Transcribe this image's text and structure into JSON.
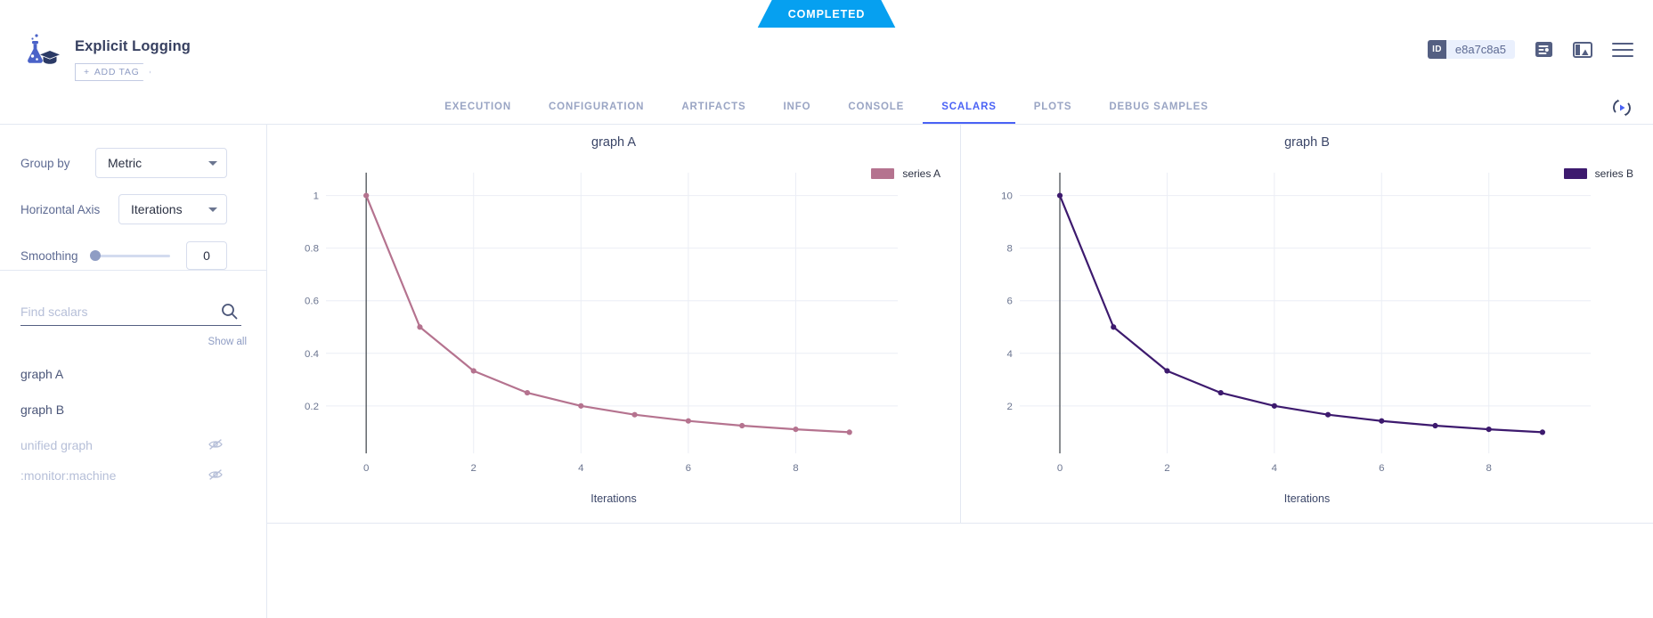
{
  "status": {
    "label": "COMPLETED",
    "color": "#06a0f0"
  },
  "header": {
    "title": "Explicit Logging",
    "add_tag_label": "ADD TAG",
    "add_tag_plus": "+",
    "logo_icon": "flask-graduation-cap-icon",
    "id_key": "ID",
    "id_value": "e8a7c8a5",
    "log_icon": "log-view-icon",
    "panel_icon": "split-panel-icon",
    "menu_icon": "hamburger-menu-icon"
  },
  "tabs": [
    {
      "label": "EXECUTION",
      "active": false
    },
    {
      "label": "CONFIGURATION",
      "active": false
    },
    {
      "label": "ARTIFACTS",
      "active": false
    },
    {
      "label": "INFO",
      "active": false
    },
    {
      "label": "CONSOLE",
      "active": false
    },
    {
      "label": "SCALARS",
      "active": true
    },
    {
      "label": "PLOTS",
      "active": false
    },
    {
      "label": "DEBUG SAMPLES",
      "active": false
    }
  ],
  "refresh_icon": "auto-refresh-icon",
  "sidebar": {
    "group_by_label": "Group by",
    "group_by_value": "Metric",
    "horizontal_axis_label": "Horizontal Axis",
    "horizontal_axis_value": "Iterations",
    "smoothing_label": "Smoothing",
    "smoothing_value": "0",
    "search_placeholder": "Find scalars",
    "search_value": "",
    "search_icon": "search-icon",
    "show_all_label": "Show all",
    "scalars": [
      {
        "label": "graph A",
        "visible": true
      },
      {
        "label": "graph B",
        "visible": true
      },
      {
        "label": "unified graph",
        "visible": false
      },
      {
        "label": ":monitor:machine",
        "visible": false
      }
    ],
    "eye_off_icon": "eye-off-icon"
  },
  "chart_data": [
    {
      "type": "line",
      "title": "graph A",
      "xlabel": "Iterations",
      "ylabel": "",
      "x": [
        0,
        1,
        2,
        3,
        4,
        5,
        6,
        7,
        8,
        9
      ],
      "xticks": [
        0,
        2,
        4,
        6,
        8
      ],
      "yticks": [
        0.2,
        0.4,
        0.6,
        0.8,
        1
      ],
      "ytick_labels": [
        "0.2",
        "0.4",
        "0.6",
        "0.8",
        "1"
      ],
      "xlim": [
        -0.55,
        9.9
      ],
      "ylim": [
        0.06,
        1.06
      ],
      "grid": true,
      "legend_position": "top-right",
      "series": [
        {
          "name": "series A",
          "color": "#b5738f",
          "values": [
            1,
            0.5,
            0.3333,
            0.25,
            0.2,
            0.1667,
            0.1429,
            0.125,
            0.1111,
            0.1
          ]
        }
      ]
    },
    {
      "type": "line",
      "title": "graph B",
      "xlabel": "Iterations",
      "ylabel": "",
      "x": [
        0,
        1,
        2,
        3,
        4,
        5,
        6,
        7,
        8,
        9
      ],
      "xticks": [
        0,
        2,
        4,
        6,
        8
      ],
      "yticks": [
        2,
        4,
        6,
        8,
        10
      ],
      "ytick_labels": [
        "2",
        "4",
        "6",
        "8",
        "10"
      ],
      "xlim": [
        -0.55,
        9.9
      ],
      "ylim": [
        0.6,
        10.6
      ],
      "grid": true,
      "legend_position": "top-right",
      "series": [
        {
          "name": "series B",
          "color": "#3d1a6e",
          "values": [
            10,
            5,
            3.3333,
            2.5,
            2,
            1.6667,
            1.4286,
            1.25,
            1.1111,
            1
          ]
        }
      ]
    }
  ]
}
